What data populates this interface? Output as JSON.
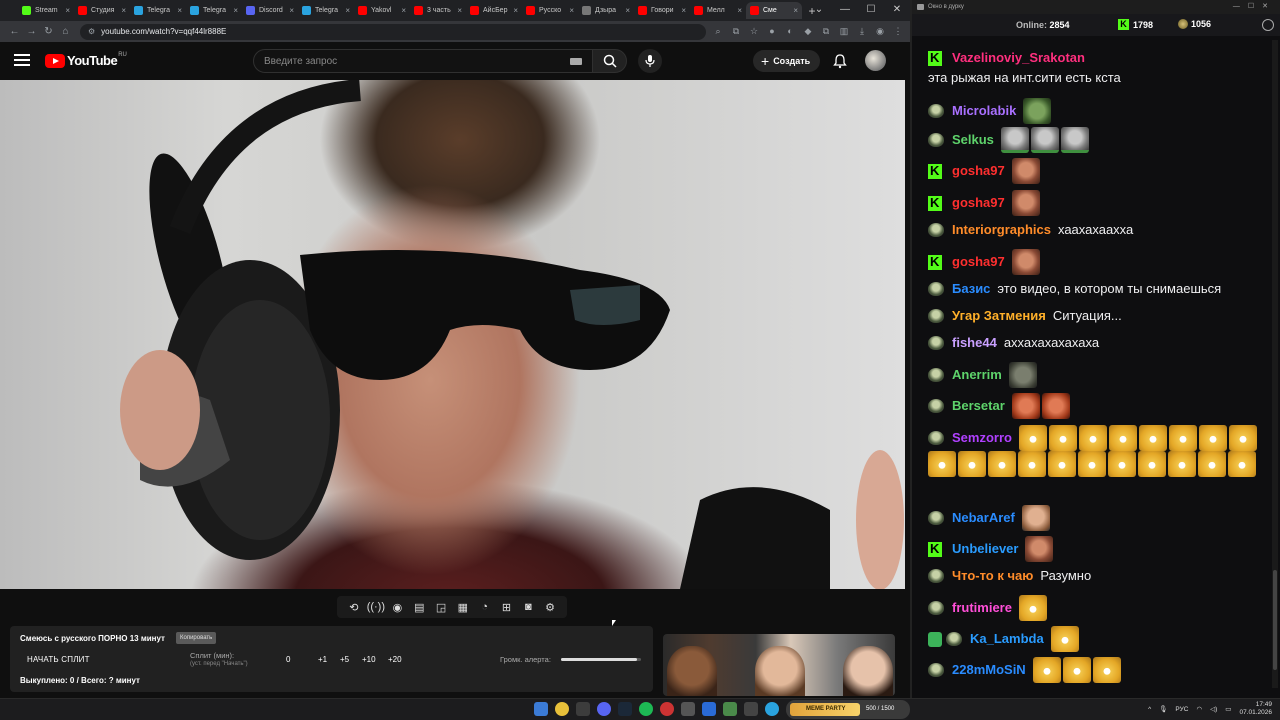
{
  "browser": {
    "tabs": [
      {
        "label": "Stream",
        "color": "#53fc18"
      },
      {
        "label": "Студия",
        "color": "#ff0000"
      },
      {
        "label": "Telegra",
        "color": "#2aa3df"
      },
      {
        "label": "Telegra",
        "color": "#2aa3df"
      },
      {
        "label": "Discord",
        "color": "#5865f2"
      },
      {
        "label": "Telegra",
        "color": "#2aa3df"
      },
      {
        "label": "Yakovl",
        "color": "#ff0000"
      },
      {
        "label": "3 часть",
        "color": "#ff0000"
      },
      {
        "label": "АйсБер",
        "color": "#ff0000"
      },
      {
        "label": "Русско",
        "color": "#ff0000"
      },
      {
        "label": "Дзыра",
        "color": "#777777"
      },
      {
        "label": "Говори",
        "color": "#ff0000"
      },
      {
        "label": "Мелл",
        "color": "#ff0000"
      },
      {
        "label": "Сме",
        "color": "#ff0000"
      }
    ],
    "active_tab": 13,
    "url": "youtube.com/watch?v=qqf44lr888E"
  },
  "youtube": {
    "logo": "YouTube",
    "region": "RU",
    "search_placeholder": "Введите запрос",
    "create_label": "Создать"
  },
  "extension": {
    "title": "Смеюсь с русского ПОРНО 13 минут",
    "copy_label": "Копировать",
    "start_label": "НАЧАТЬ СПЛИТ",
    "split_label": "Сплит (мин):",
    "split_hint": "(уст. перед \"Начать\")",
    "split_value": "0",
    "increments": [
      "+1",
      "+5",
      "+10",
      "+20"
    ],
    "alert_label": "Громк. алерта:",
    "alert_volume": 0.95,
    "footer": "Выкуплено: 0 / Всего: ? минут"
  },
  "thumbnail": {
    "badge": "MEME PARTY"
  },
  "chat": {
    "window_title": "Окно в дурку",
    "online_label": "Online:",
    "online_value": "2854",
    "kick_count": "1798",
    "coin_count": "1056",
    "messages": [
      {
        "badge": "k",
        "user": "Vazelinoviy_Srakotan",
        "color": "#ff2f7e",
        "text": "эта рыжая на инт.сити есть кста",
        "emotes": []
      },
      {
        "badge": "round",
        "user": "Microlabik",
        "color": "#a970ff",
        "text": "",
        "emotes": [
          "pepe"
        ]
      },
      {
        "badge": "round",
        "user": "Selkus",
        "color": "#5ed36b",
        "text": "",
        "emotes": [
          "grey",
          "grey",
          "grey"
        ]
      },
      {
        "badge": "k",
        "user": "gosha97",
        "color": "#ff2f2f",
        "text": "",
        "emotes": [
          "face"
        ]
      },
      {
        "badge": "k",
        "user": "gosha97",
        "color": "#ff2f2f",
        "text": "",
        "emotes": [
          "face"
        ]
      },
      {
        "badge": "round",
        "user": "Interiorgraphics",
        "color": "#ff8c2a",
        "text": "хаахахаахха",
        "emotes": []
      },
      {
        "badge": "k",
        "user": "gosha97",
        "color": "#ff2f2f",
        "text": "",
        "emotes": [
          "face"
        ]
      },
      {
        "badge": "round",
        "user": "Базис",
        "color": "#2a8cff",
        "text": "это видео, в котором ты снимаешься",
        "emotes": []
      },
      {
        "badge": "round",
        "user": "Угар Затмения",
        "color": "#ffb02a",
        "text": "Ситуация...",
        "emotes": []
      },
      {
        "badge": "round",
        "user": "fishe44",
        "color": "#c9a0ff",
        "text": "аххахахахахаха",
        "emotes": []
      },
      {
        "badge": "round",
        "user": "Anerrim",
        "color": "#5ed36b",
        "text": "",
        "emotes": [
          "blob"
        ]
      },
      {
        "badge": "round",
        "user": "Bersetar",
        "color": "#5ed36b",
        "text": "",
        "emotes": [
          "red",
          "red"
        ]
      },
      {
        "badge": "round",
        "user": "Semzorro",
        "color": "#b040ff",
        "text": "",
        "emotes": [
          "laugh",
          "laugh",
          "laugh",
          "laugh",
          "laugh",
          "laugh",
          "laugh",
          "laugh",
          "laugh",
          "laugh",
          "laugh",
          "laugh",
          "laugh",
          "laugh",
          "laugh",
          "laugh",
          "laugh",
          "laugh",
          "laugh"
        ]
      },
      {
        "badge": "round",
        "user": "NebarAref",
        "color": "#2a8cff",
        "text": "",
        "emotes": [
          "man"
        ]
      },
      {
        "badge": "k",
        "user": "Unbeliever",
        "color": "#2a9cff",
        "text": "",
        "emotes": [
          "face"
        ]
      },
      {
        "badge": "round",
        "user": "Что-то к чаю",
        "color": "#ff8c2a",
        "text": "Разумно",
        "emotes": []
      },
      {
        "badge": "round",
        "user": "frutimiere",
        "color": "#ff4fd8",
        "text": "",
        "emotes": [
          "laugh"
        ]
      },
      {
        "badge": "shield",
        "user": "Ka_Lambda",
        "color": "#2a9cff",
        "text": "",
        "emotes": [
          "laugh"
        ]
      },
      {
        "badge": "round",
        "user": "228mMoSiN",
        "color": "#2a8cff",
        "text": "",
        "emotes": [
          "laugh",
          "laugh",
          "laugh"
        ]
      }
    ]
  },
  "taskbar": {
    "lang": "РУС",
    "time": "17:49",
    "date": "07.01.2026",
    "pill_badge": "MEME PARTY",
    "pill_text": "500 / 1500"
  }
}
